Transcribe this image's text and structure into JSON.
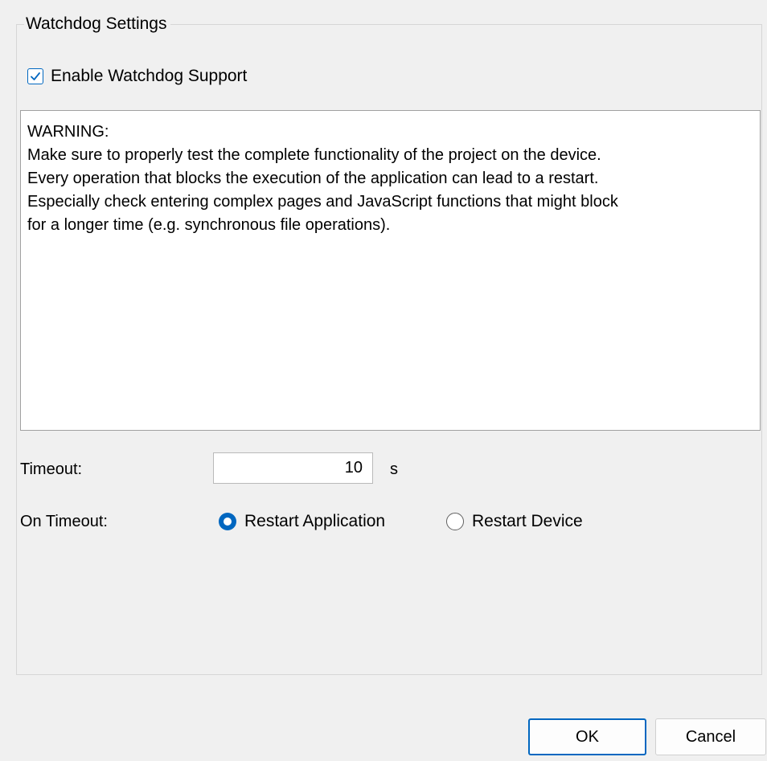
{
  "group": {
    "title": "Watchdog Settings"
  },
  "enable_checkbox": {
    "label": "Enable Watchdog Support",
    "checked": true
  },
  "warning": {
    "lines": [
      "WARNING:",
      "Make sure to properly test the complete functionality of the project on the device.",
      "Every operation that blocks the execution of the application can lead to a restart.",
      "Especially check entering complex pages and JavaScript functions that might block",
      "for a longer time (e.g. synchronous file operations)."
    ]
  },
  "timeout": {
    "label": "Timeout:",
    "value": "10",
    "unit": "s"
  },
  "on_timeout": {
    "label": "On Timeout:",
    "options": [
      {
        "label": "Restart Application",
        "selected": true
      },
      {
        "label": "Restart Device",
        "selected": false
      }
    ]
  },
  "buttons": {
    "ok": "OK",
    "cancel": "Cancel"
  },
  "colors": {
    "accent": "#0067c0",
    "background": "#f0f0f0"
  }
}
